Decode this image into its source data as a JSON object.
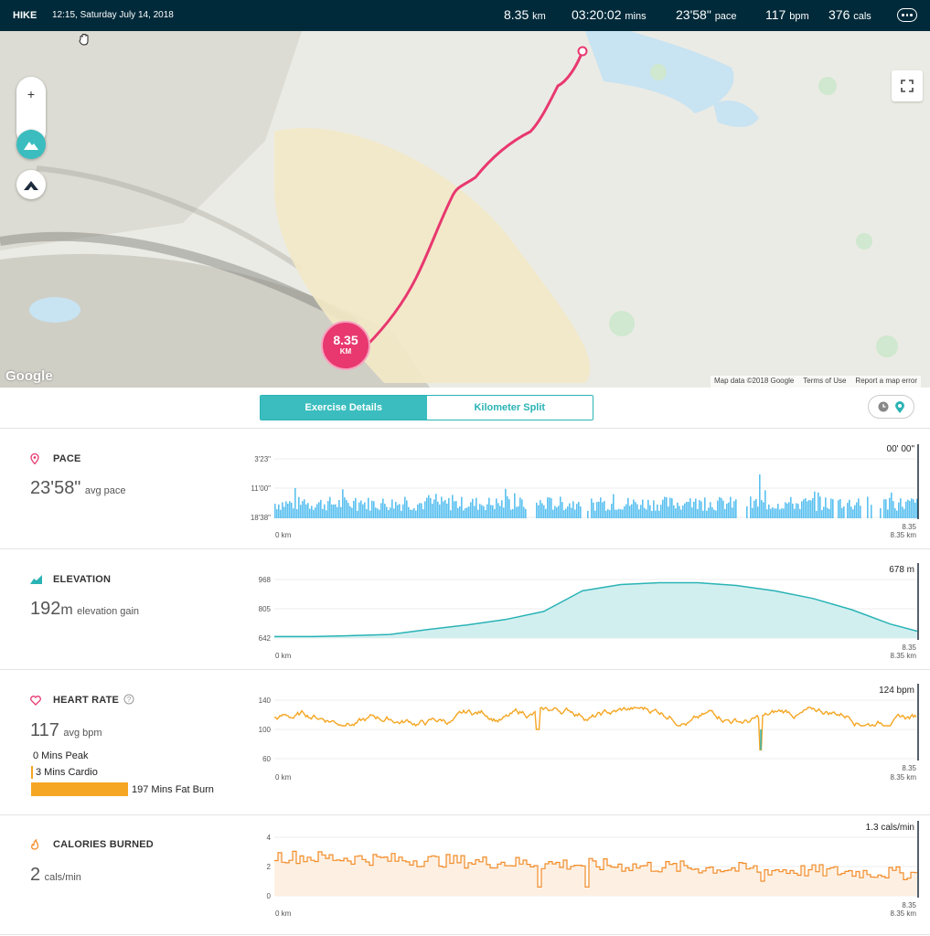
{
  "topbar": {
    "activity": "HIKE",
    "datetime": "12:15, Saturday July 14, 2018",
    "distance": "8.35",
    "distance_unit": "km",
    "duration": "03:20:02",
    "duration_unit": "mins",
    "pace": "23'58\"",
    "pace_unit": "pace",
    "heart_rate": "117",
    "heart_rate_unit": "bpm",
    "calories": "376",
    "calories_unit": "cals"
  },
  "map": {
    "zoom_in": "+",
    "zoom_out": "-",
    "marker_value": "8.35",
    "marker_unit": "KM",
    "google_logo": "Google",
    "footer": [
      "Map data ©2018 Google",
      "Terms of Use",
      "Report a map error"
    ],
    "icons": [
      "terrain-icon",
      "satellite-icon",
      "fullscreen-icon",
      "hand-cursor-icon"
    ]
  },
  "tabs": {
    "details": "Exercise Details",
    "split": "Kilometer Split",
    "toggle_icons": [
      "clock-icon",
      "location-icon"
    ]
  },
  "pace": {
    "label": "PACE",
    "value": "23'58\"",
    "suffix": "avg pace",
    "current": "00' 00\"",
    "ticks": [
      "3'23\"",
      "11'00\"",
      "18'38\""
    ],
    "x_start": "0 km",
    "x_end_top": "8.35",
    "x_end_bottom": "8.35 km",
    "color": "#5bc0f0"
  },
  "elevation": {
    "label": "ELEVATION",
    "value": "192",
    "value_unit": "m",
    "suffix": "elevation gain",
    "current": "678 m",
    "ticks": [
      "968",
      "805",
      "642"
    ],
    "x_start": "0 km",
    "x_end_top": "8.35",
    "x_end_bottom": "8.35 km",
    "color": "#2ab3b5"
  },
  "heart_rate": {
    "label": "HEART RATE",
    "value": "117",
    "suffix": "avg bpm",
    "current": "124 bpm",
    "ticks": [
      "140",
      "100",
      "60"
    ],
    "x_start": "0 km",
    "x_end_top": "8.35",
    "x_end_bottom": "8.35 km",
    "zones": [
      {
        "label": "0 Mins Peak",
        "minutes": 0
      },
      {
        "label": "3 Mins Cardio",
        "minutes": 3
      },
      {
        "label": "197 Mins Fat Burn",
        "minutes": 197
      }
    ],
    "color": "#f5a623"
  },
  "calories": {
    "label": "CALORIES BURNED",
    "value": "2",
    "suffix": "cals/min",
    "current": "1.3 cals/min",
    "ticks": [
      "4",
      "2",
      "0"
    ],
    "x_start": "0 km",
    "x_end_top": "8.35",
    "x_end_bottom": "8.35 km",
    "color": "#f28c28"
  },
  "chart_data": [
    {
      "type": "bar",
      "title": "PACE",
      "x_range": [
        0,
        8.35
      ],
      "ylim": [
        "3'23\"",
        "18'38\""
      ],
      "note_series": "dense pace samples across 0-8.35 km"
    },
    {
      "type": "area",
      "title": "ELEVATION",
      "x": [
        0,
        0.5,
        1.0,
        1.5,
        2.0,
        2.5,
        3.0,
        3.5,
        4.0,
        4.5,
        5.0,
        5.5,
        6.0,
        6.5,
        7.0,
        7.5,
        8.0,
        8.35
      ],
      "values": [
        650,
        650,
        655,
        662,
        690,
        715,
        745,
        790,
        905,
        940,
        950,
        950,
        935,
        905,
        862,
        800,
        720,
        680
      ],
      "ylim": [
        642,
        968
      ]
    },
    {
      "type": "line",
      "title": "HEART RATE",
      "x_range": [
        0,
        8.35
      ],
      "ylim": [
        60,
        140
      ],
      "note_series": "approx. 105-130 bpm throughout, brief dip near 6.2 km"
    },
    {
      "type": "area",
      "title": "CALORIES BURNED",
      "x_range": [
        0,
        8.35
      ],
      "ylim": [
        0,
        4
      ],
      "note_series": "approx. 1.5-3 cals/min, declining gradually"
    }
  ]
}
